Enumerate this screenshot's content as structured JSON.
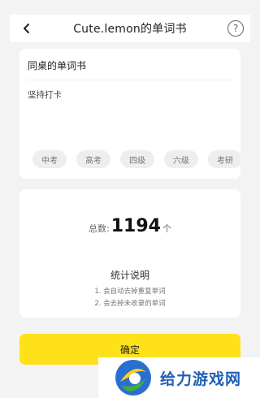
{
  "header": {
    "title": "Cute.lemon的单词书",
    "back_icon": "chevron-left-icon",
    "help_symbol": "?"
  },
  "book": {
    "name": "同桌的单词书",
    "description": "坚持打卡",
    "tags": [
      "中考",
      "高考",
      "四级",
      "六级",
      "考研"
    ]
  },
  "stats": {
    "total_label": "总数:",
    "total_value": "1194",
    "total_unit": "个",
    "explain_title": "统计说明",
    "notes": [
      "1. 会自动去掉重复单词",
      "2. 会去掉未收录的单词"
    ]
  },
  "confirm_label": "确定",
  "watermark": {
    "text": "给力游戏网",
    "colors": {
      "text": "#1f5fb8",
      "blue": "#2a6fd0",
      "yellow": "#f7d21c",
      "green": "#3fae3a"
    }
  },
  "colors": {
    "accent": "#ffe11a",
    "background": "#f3f3f3"
  }
}
